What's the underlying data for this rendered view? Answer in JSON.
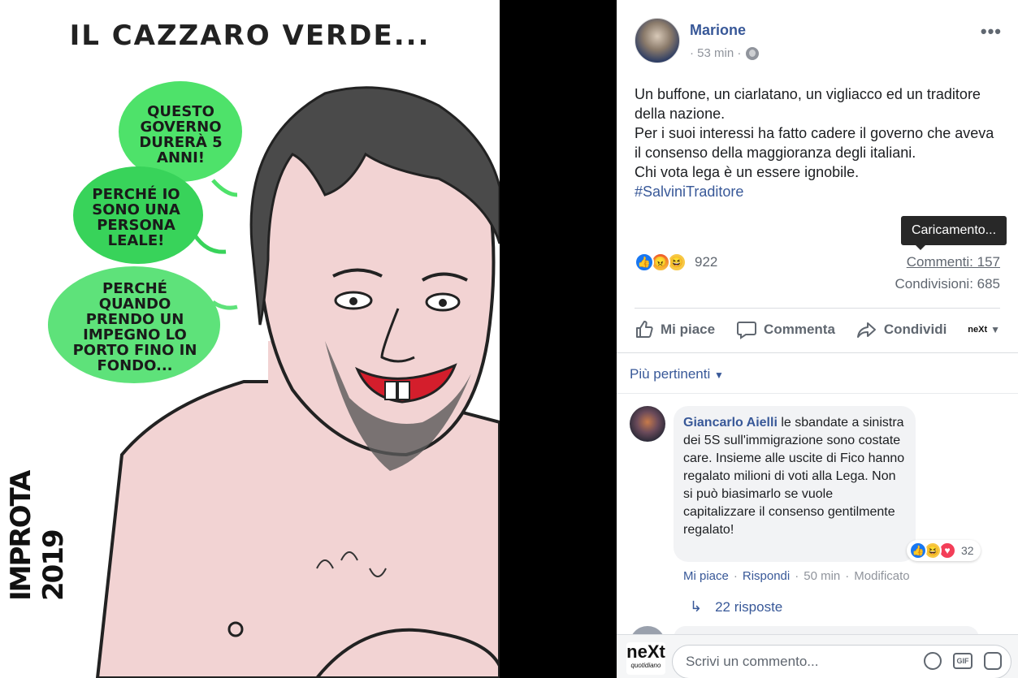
{
  "cartoon": {
    "title": "IL CAZZARO VERDE...",
    "bubbles": [
      "QUESTO GOVERNO DURERÀ 5 ANNI!",
      "PERCHÉ IO SONO UNA PERSONA LEALE!",
      "PERCHÉ QUANDO PRENDO UN IMPEGNO LO PORTO FINO IN FONDO..."
    ],
    "signature": "IMPROTA 2019"
  },
  "post": {
    "author": "Marione",
    "time": "· 53 min ·",
    "text_lines": [
      "Un buffone, un ciarlatano, un vigliacco ed un traditore della nazione.",
      "Per i suoi interessi ha fatto cadere il governo che aveva il consenso della maggioranza degli italiani.",
      "Chi vota lega è un essere ignobile."
    ],
    "hashtag": "#SalviniTraditore",
    "tooltip": "Caricamento...",
    "reaction_count": "922",
    "comments_label": "Commenti: 157",
    "shares_label": "Condivisioni: 685",
    "actions": {
      "like": "Mi piace",
      "comment": "Commenta",
      "share": "Condividi"
    },
    "share_as_logo": "neXt"
  },
  "comments": {
    "sort_label": "Più pertinenti",
    "items": [
      {
        "author": "Giancarlo Aielli",
        "text": "le sbandate a sinistra dei 5S sull'immigrazione sono costate care. Insieme alle uscite di Fico hanno regalato milioni di voti alla Lega. Non si può biasimarlo se vuole capitalizzare il consenso gentilmente regalato!",
        "reaction_count": "32",
        "like": "Mi piace",
        "reply": "Rispondi",
        "time": "50 min",
        "edited": "Modificato",
        "replies_label": "22 risposte"
      }
    ]
  },
  "composer": {
    "placeholder": "Scrivi un commento...",
    "avatar_big": "neXt",
    "avatar_small": "quotidiano"
  }
}
